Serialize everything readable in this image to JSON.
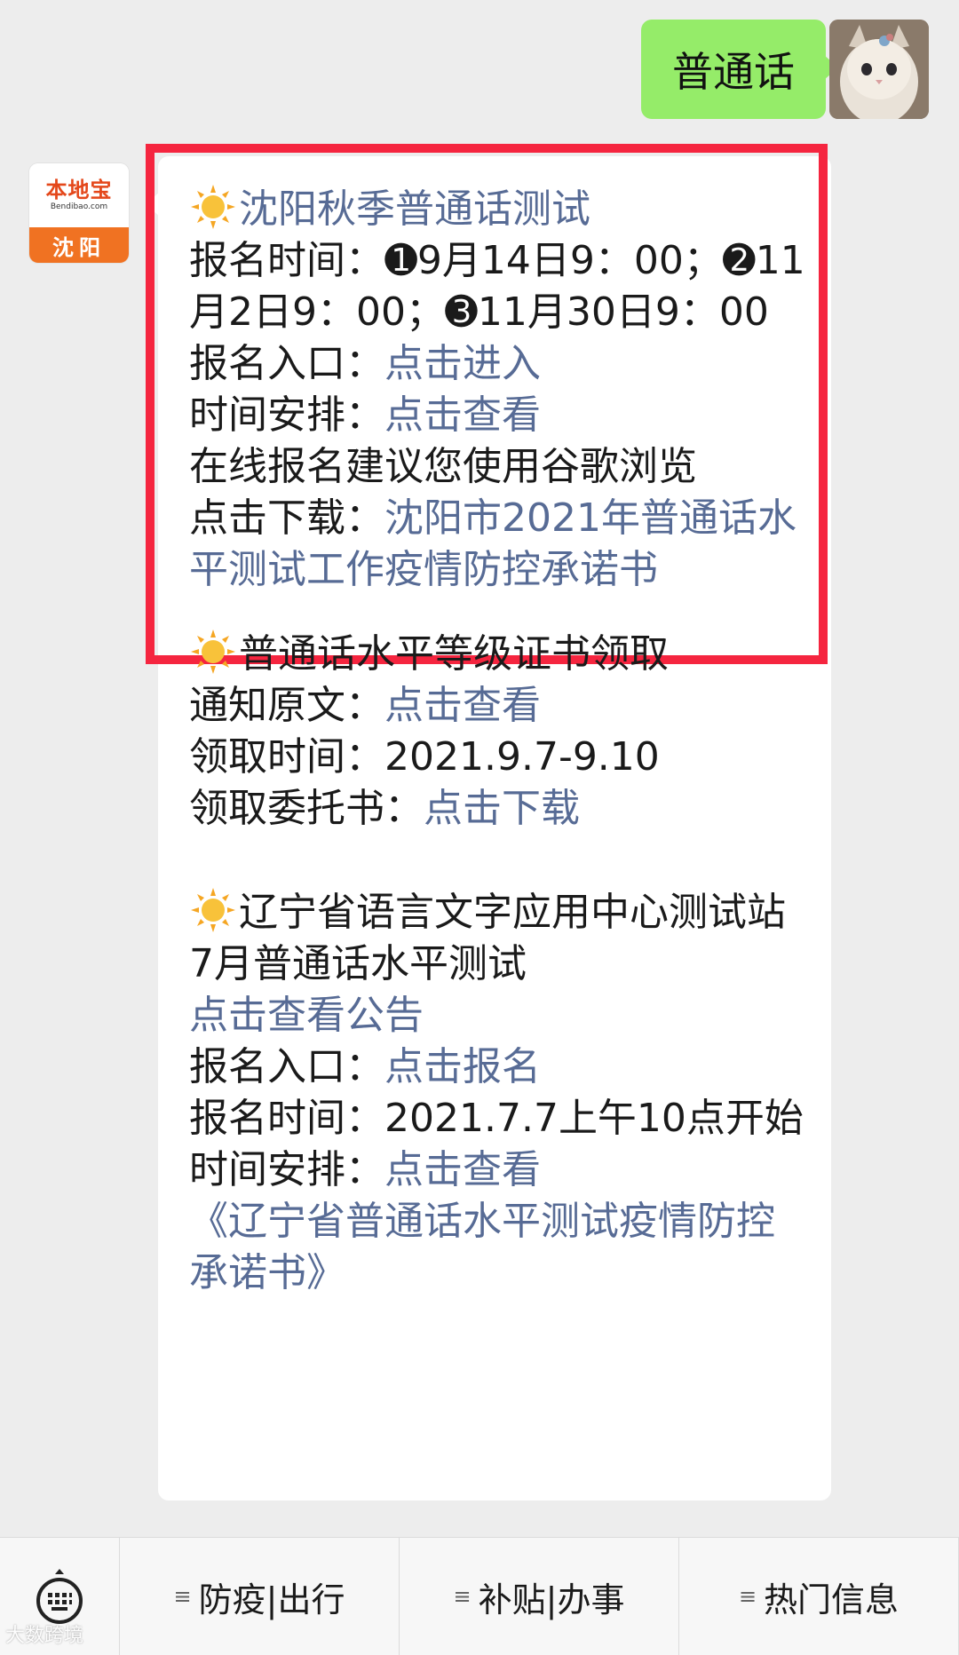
{
  "user_message": {
    "text": "普通话"
  },
  "bot": {
    "avatar_brand": "本地宝",
    "avatar_domain": "Bendibao.com",
    "avatar_city": "沈阳"
  },
  "message": {
    "section1": {
      "title": "沈阳秋季普通话测试",
      "signup_time_label": "报名时间：",
      "signup_time_1_num": "➊",
      "signup_time_1": "9月14日9：00；",
      "signup_time_2_num": "➋",
      "signup_time_2": "11月2日9：00；",
      "signup_time_3_num": "➌",
      "signup_time_3": "11月30日9：00",
      "entry_label": "报名入口：",
      "entry_link": "点击进入",
      "schedule_label": "时间安排：",
      "schedule_link": "点击查看",
      "browser_tip": "在线报名建议您使用谷歌浏览",
      "download_label": "点击下载：",
      "download_link": "沈阳市2021年普通话水平测试工作疫情防控承诺书"
    },
    "section2": {
      "title": "普通话水平等级证书领取",
      "notice_label": "通知原文：",
      "notice_link": "点击查看",
      "pickup_time_label": "领取时间：",
      "pickup_time": "2021.9.7-9.10",
      "proxy_label": "领取委托书：",
      "proxy_link": "点击下载"
    },
    "section3": {
      "title": "辽宁省语言文字应用中心测试站",
      "subtitle": "7月普通话水平测试",
      "announce_link": "点击查看公告",
      "entry_label": "报名入口：",
      "entry_link": "点击报名",
      "signup_time_label": "报名时间：",
      "signup_time": "2021.7.7上午10点开始",
      "schedule_label": "时间安排：",
      "schedule_link": "点击查看",
      "pledge_link": "《辽宁省普通话水平测试疫情防控承诺书》"
    }
  },
  "menu": {
    "keyboard_icon": "keyboard-icon",
    "items": [
      {
        "label": "防疫|出行"
      },
      {
        "label": "补贴|办事"
      },
      {
        "label": "热门信息"
      }
    ]
  },
  "watermark": "大数跨境",
  "colors": {
    "link": "#576b95",
    "user_bubble": "#95ec69",
    "highlight": "#f5253f"
  }
}
